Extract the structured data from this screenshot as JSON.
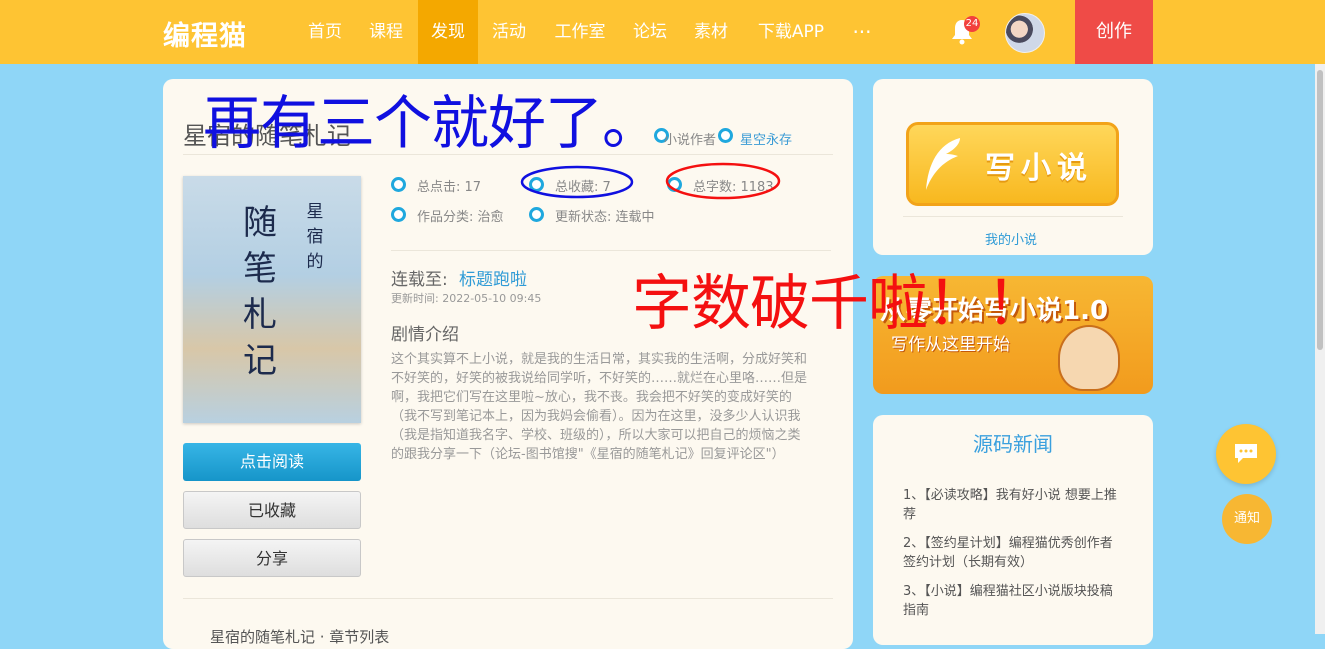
{
  "nav": {
    "logo": "编程猫",
    "items": [
      {
        "label": "首页"
      },
      {
        "label": "课程"
      },
      {
        "label": "发现",
        "active": true
      },
      {
        "label": "活动"
      },
      {
        "label": "工作室"
      },
      {
        "label": "论坛"
      },
      {
        "label": "素材"
      },
      {
        "label": "下载APP"
      }
    ],
    "more": "···",
    "notification_count": "24",
    "create_label": "创作"
  },
  "book": {
    "title": "星宿的随笔札记",
    "author_label": "小说作者",
    "author": "星空永存",
    "cover": {
      "big_text": "随笔札记",
      "small_text": "星宿的"
    },
    "stats": {
      "clicks": "总点击: 17",
      "favorites": "总收藏: 7",
      "word_count": "总字数: 1183",
      "category": "作品分类: 治愈",
      "status": "更新状态: 连载中"
    },
    "serial_label": "连载至:",
    "latest_chapter": "标题跑啦",
    "update_time": "更新时间: 2022-05-10 09:45",
    "synopsis_label": "剧情介绍",
    "synopsis": "这个其实算不上小说，就是我的生活日常，其实我的生活啊，分成好笑和不好笑的，好笑的被我说给同学听，不好笑的……就烂在心里咯……但是啊，我把它们写在这里啦~放心，我不丧。我会把不好笑的变成好笑的（我不写到笔记本上，因为我妈会偷看）。因为在这里，没多少人认识我（我是指知道我名字、学校、班级的），所以大家可以把自己的烦恼之类的跟我分享一下（论坛-图书馆搜\"《星宿的随笔札记》回复评论区\"）",
    "buttons": {
      "read": "点击阅读",
      "favorited": "已收藏",
      "share": "分享"
    },
    "bottom_text": "星宿的随笔札记 · 章节列表"
  },
  "annotations": {
    "blue_text": "再有三个就好了。",
    "red_text": "字数破千啦！！",
    "blue_color": "#1010e0",
    "red_color": "#f41010"
  },
  "sidebar": {
    "write_button": "写小说",
    "my_novels": "我的小说",
    "banner_title": "从零开始写小说1.0",
    "banner_subtitle": "写作从这里开始",
    "news_title": "源码新闻",
    "news": [
      "1、【必读攻略】我有好小说 想要上推荐",
      "2、【签约星计划】编程猫优秀创作者签约计划（长期有效）",
      "3、【小说】编程猫社区小说版块投稿指南"
    ],
    "notice_label": "通知"
  },
  "icons": [
    "bell-icon",
    "chat-icon",
    "quill-icon",
    "more-icon"
  ]
}
